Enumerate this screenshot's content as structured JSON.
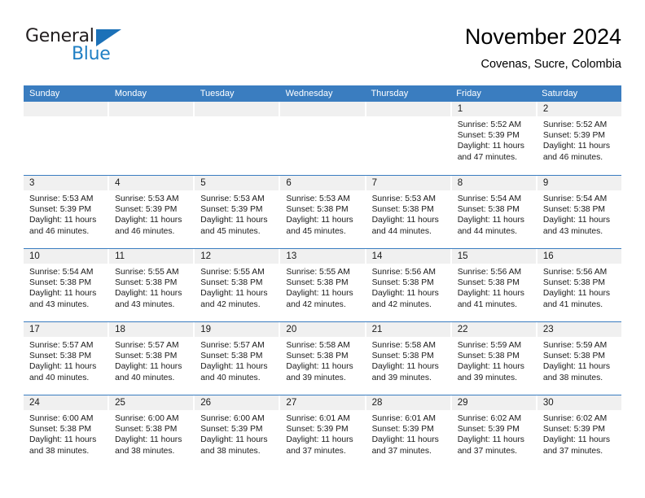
{
  "brand": {
    "name_top": "General",
    "name_bottom": "Blue",
    "triangle_icon": "triangle-icon",
    "color_dark": "#231f20",
    "color_blue": "#1f7fc4"
  },
  "header": {
    "title": "November 2024",
    "subtitle": "Covenas, Sucre, Colombia"
  },
  "theme": {
    "header_blue": "#3a7dc0",
    "day_band_gray": "#f0f0f0",
    "row_divider": "#3a7dc0"
  },
  "calendar": {
    "weekdays": [
      "Sunday",
      "Monday",
      "Tuesday",
      "Wednesday",
      "Thursday",
      "Friday",
      "Saturday"
    ],
    "weeks": [
      [
        {
          "day": "",
          "sunrise": "",
          "sunset": "",
          "daylight": ""
        },
        {
          "day": "",
          "sunrise": "",
          "sunset": "",
          "daylight": ""
        },
        {
          "day": "",
          "sunrise": "",
          "sunset": "",
          "daylight": ""
        },
        {
          "day": "",
          "sunrise": "",
          "sunset": "",
          "daylight": ""
        },
        {
          "day": "",
          "sunrise": "",
          "sunset": "",
          "daylight": ""
        },
        {
          "day": "1",
          "sunrise": "Sunrise: 5:52 AM",
          "sunset": "Sunset: 5:39 PM",
          "daylight": "Daylight: 11 hours and 47 minutes."
        },
        {
          "day": "2",
          "sunrise": "Sunrise: 5:52 AM",
          "sunset": "Sunset: 5:39 PM",
          "daylight": "Daylight: 11 hours and 46 minutes."
        }
      ],
      [
        {
          "day": "3",
          "sunrise": "Sunrise: 5:53 AM",
          "sunset": "Sunset: 5:39 PM",
          "daylight": "Daylight: 11 hours and 46 minutes."
        },
        {
          "day": "4",
          "sunrise": "Sunrise: 5:53 AM",
          "sunset": "Sunset: 5:39 PM",
          "daylight": "Daylight: 11 hours and 46 minutes."
        },
        {
          "day": "5",
          "sunrise": "Sunrise: 5:53 AM",
          "sunset": "Sunset: 5:39 PM",
          "daylight": "Daylight: 11 hours and 45 minutes."
        },
        {
          "day": "6",
          "sunrise": "Sunrise: 5:53 AM",
          "sunset": "Sunset: 5:38 PM",
          "daylight": "Daylight: 11 hours and 45 minutes."
        },
        {
          "day": "7",
          "sunrise": "Sunrise: 5:53 AM",
          "sunset": "Sunset: 5:38 PM",
          "daylight": "Daylight: 11 hours and 44 minutes."
        },
        {
          "day": "8",
          "sunrise": "Sunrise: 5:54 AM",
          "sunset": "Sunset: 5:38 PM",
          "daylight": "Daylight: 11 hours and 44 minutes."
        },
        {
          "day": "9",
          "sunrise": "Sunrise: 5:54 AM",
          "sunset": "Sunset: 5:38 PM",
          "daylight": "Daylight: 11 hours and 43 minutes."
        }
      ],
      [
        {
          "day": "10",
          "sunrise": "Sunrise: 5:54 AM",
          "sunset": "Sunset: 5:38 PM",
          "daylight": "Daylight: 11 hours and 43 minutes."
        },
        {
          "day": "11",
          "sunrise": "Sunrise: 5:55 AM",
          "sunset": "Sunset: 5:38 PM",
          "daylight": "Daylight: 11 hours and 43 minutes."
        },
        {
          "day": "12",
          "sunrise": "Sunrise: 5:55 AM",
          "sunset": "Sunset: 5:38 PM",
          "daylight": "Daylight: 11 hours and 42 minutes."
        },
        {
          "day": "13",
          "sunrise": "Sunrise: 5:55 AM",
          "sunset": "Sunset: 5:38 PM",
          "daylight": "Daylight: 11 hours and 42 minutes."
        },
        {
          "day": "14",
          "sunrise": "Sunrise: 5:56 AM",
          "sunset": "Sunset: 5:38 PM",
          "daylight": "Daylight: 11 hours and 42 minutes."
        },
        {
          "day": "15",
          "sunrise": "Sunrise: 5:56 AM",
          "sunset": "Sunset: 5:38 PM",
          "daylight": "Daylight: 11 hours and 41 minutes."
        },
        {
          "day": "16",
          "sunrise": "Sunrise: 5:56 AM",
          "sunset": "Sunset: 5:38 PM",
          "daylight": "Daylight: 11 hours and 41 minutes."
        }
      ],
      [
        {
          "day": "17",
          "sunrise": "Sunrise: 5:57 AM",
          "sunset": "Sunset: 5:38 PM",
          "daylight": "Daylight: 11 hours and 40 minutes."
        },
        {
          "day": "18",
          "sunrise": "Sunrise: 5:57 AM",
          "sunset": "Sunset: 5:38 PM",
          "daylight": "Daylight: 11 hours and 40 minutes."
        },
        {
          "day": "19",
          "sunrise": "Sunrise: 5:57 AM",
          "sunset": "Sunset: 5:38 PM",
          "daylight": "Daylight: 11 hours and 40 minutes."
        },
        {
          "day": "20",
          "sunrise": "Sunrise: 5:58 AM",
          "sunset": "Sunset: 5:38 PM",
          "daylight": "Daylight: 11 hours and 39 minutes."
        },
        {
          "day": "21",
          "sunrise": "Sunrise: 5:58 AM",
          "sunset": "Sunset: 5:38 PM",
          "daylight": "Daylight: 11 hours and 39 minutes."
        },
        {
          "day": "22",
          "sunrise": "Sunrise: 5:59 AM",
          "sunset": "Sunset: 5:38 PM",
          "daylight": "Daylight: 11 hours and 39 minutes."
        },
        {
          "day": "23",
          "sunrise": "Sunrise: 5:59 AM",
          "sunset": "Sunset: 5:38 PM",
          "daylight": "Daylight: 11 hours and 38 minutes."
        }
      ],
      [
        {
          "day": "24",
          "sunrise": "Sunrise: 6:00 AM",
          "sunset": "Sunset: 5:38 PM",
          "daylight": "Daylight: 11 hours and 38 minutes."
        },
        {
          "day": "25",
          "sunrise": "Sunrise: 6:00 AM",
          "sunset": "Sunset: 5:38 PM",
          "daylight": "Daylight: 11 hours and 38 minutes."
        },
        {
          "day": "26",
          "sunrise": "Sunrise: 6:00 AM",
          "sunset": "Sunset: 5:39 PM",
          "daylight": "Daylight: 11 hours and 38 minutes."
        },
        {
          "day": "27",
          "sunrise": "Sunrise: 6:01 AM",
          "sunset": "Sunset: 5:39 PM",
          "daylight": "Daylight: 11 hours and 37 minutes."
        },
        {
          "day": "28",
          "sunrise": "Sunrise: 6:01 AM",
          "sunset": "Sunset: 5:39 PM",
          "daylight": "Daylight: 11 hours and 37 minutes."
        },
        {
          "day": "29",
          "sunrise": "Sunrise: 6:02 AM",
          "sunset": "Sunset: 5:39 PM",
          "daylight": "Daylight: 11 hours and 37 minutes."
        },
        {
          "day": "30",
          "sunrise": "Sunrise: 6:02 AM",
          "sunset": "Sunset: 5:39 PM",
          "daylight": "Daylight: 11 hours and 37 minutes."
        }
      ]
    ]
  }
}
